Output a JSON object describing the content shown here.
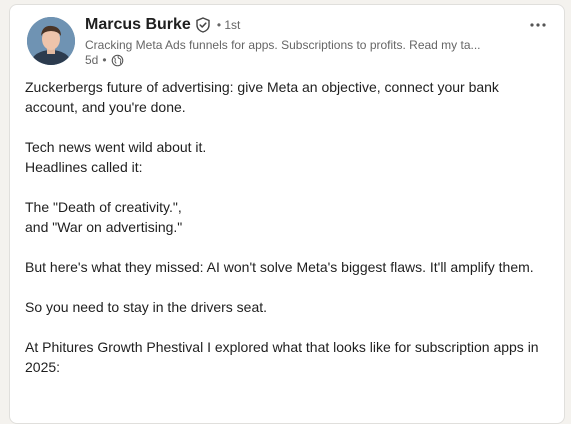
{
  "author": {
    "name": "Marcus Burke",
    "degree": "• 1st",
    "headline": "Cracking Meta Ads funnels for apps. Subscriptions to profits. Read my ta...",
    "age": "5d",
    "separator": "•"
  },
  "icons": {
    "verified": "shield-check-icon",
    "visibility": "globe-icon",
    "more": "ellipsis-icon"
  },
  "post": {
    "p1": "Zuckerbergs future of advertising: give Meta an objective, connect your bank account, and you're done.",
    "p2a": "Tech news went wild about it.",
    "p2b": "Headlines called it:",
    "p3a": "The \"Death of creativity.\",",
    "p3b": "and \"War on advertising.\"",
    "p4": "But here's what they missed: AI won't solve Meta's biggest flaws. It'll amplify them.",
    "p5": "So you need to stay in the drivers seat.",
    "p6": "At Phitures Growth Phestival I explored what that looks like for subscription apps in 2025:"
  },
  "colors": {
    "background": "#f4f2ee",
    "card": "#ffffff",
    "text": "#1f1f1f",
    "muted": "#666666"
  }
}
